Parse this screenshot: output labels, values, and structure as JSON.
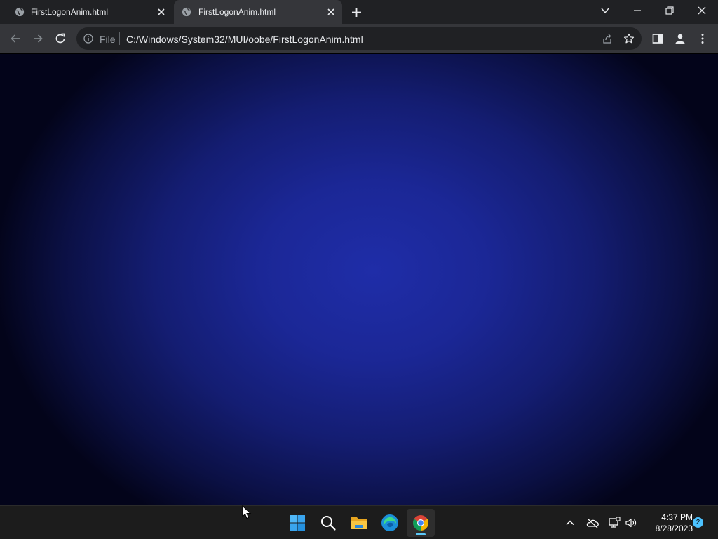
{
  "tabs": [
    {
      "title": "FirstLogonAnim.html",
      "active": false
    },
    {
      "title": "FirstLogonAnim.html",
      "active": true
    }
  ],
  "toolbar": {
    "scheme_label": "File",
    "url": "C:/Windows/System32/MUI/oobe/FirstLogonAnim.html"
  },
  "icons": {
    "tab_favicon": "globe-icon",
    "back": "arrow-left-icon",
    "forward": "arrow-right-icon",
    "reload": "reload-icon",
    "info": "info-icon",
    "share": "share-icon",
    "bookmark": "star-icon",
    "side_panel": "side-panel-icon",
    "profile": "person-icon",
    "menu": "kebab-menu-icon"
  },
  "taskbar": {
    "apps": [
      "start",
      "search",
      "file-explorer",
      "edge",
      "chrome"
    ],
    "active_app": "chrome",
    "clock_time": "4:37 PM",
    "clock_date": "8/28/2023",
    "notification_count": "2"
  },
  "colors": {
    "page_center": "#1f2da8",
    "page_edge": "#03041a",
    "chrome_dark": "#202124",
    "chrome_toolbar": "#35363a",
    "taskbar": "#1c1c1c",
    "accent": "#4cc2ff"
  }
}
